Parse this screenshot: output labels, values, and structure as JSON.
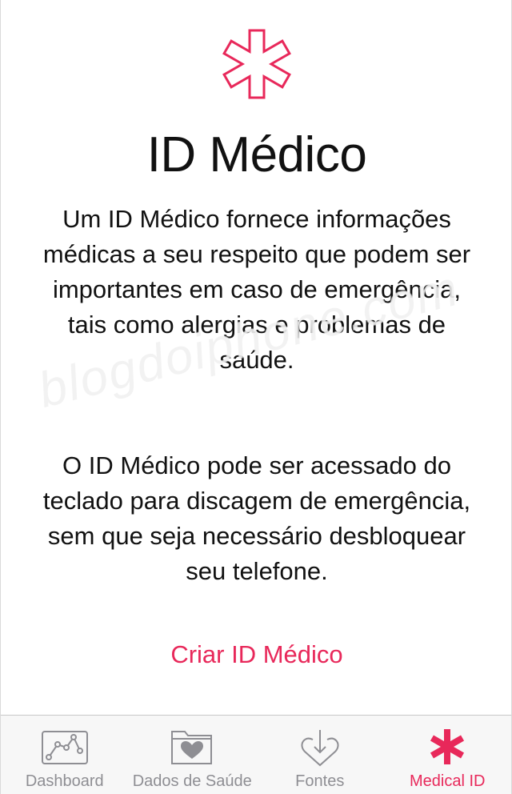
{
  "hero": {
    "icon": "medical-asterisk-icon",
    "color": "#e8285a"
  },
  "title": "ID Médico",
  "paragraph1": "Um ID Médico fornece informações médicas a seu respeito que podem ser importantes em caso de emergência, tais como alergias e problemas de saúde.",
  "paragraph2": "O ID Médico pode ser acessado do teclado para discagem de emergência, sem que seja necessário desbloquear seu telefone.",
  "create_button": "Criar ID Médico",
  "watermark": "blogdoiphone.com",
  "accent_color": "#e8285a",
  "tabbar": {
    "tabs": [
      {
        "label": "Dashboard",
        "icon": "chart-line-icon",
        "active": false
      },
      {
        "label": "Dados de Saúde",
        "icon": "folder-heart-icon",
        "active": false
      },
      {
        "label": "Fontes",
        "icon": "download-heart-icon",
        "active": false
      },
      {
        "label": "Medical ID",
        "icon": "medical-asterisk-icon",
        "active": true
      }
    ]
  }
}
